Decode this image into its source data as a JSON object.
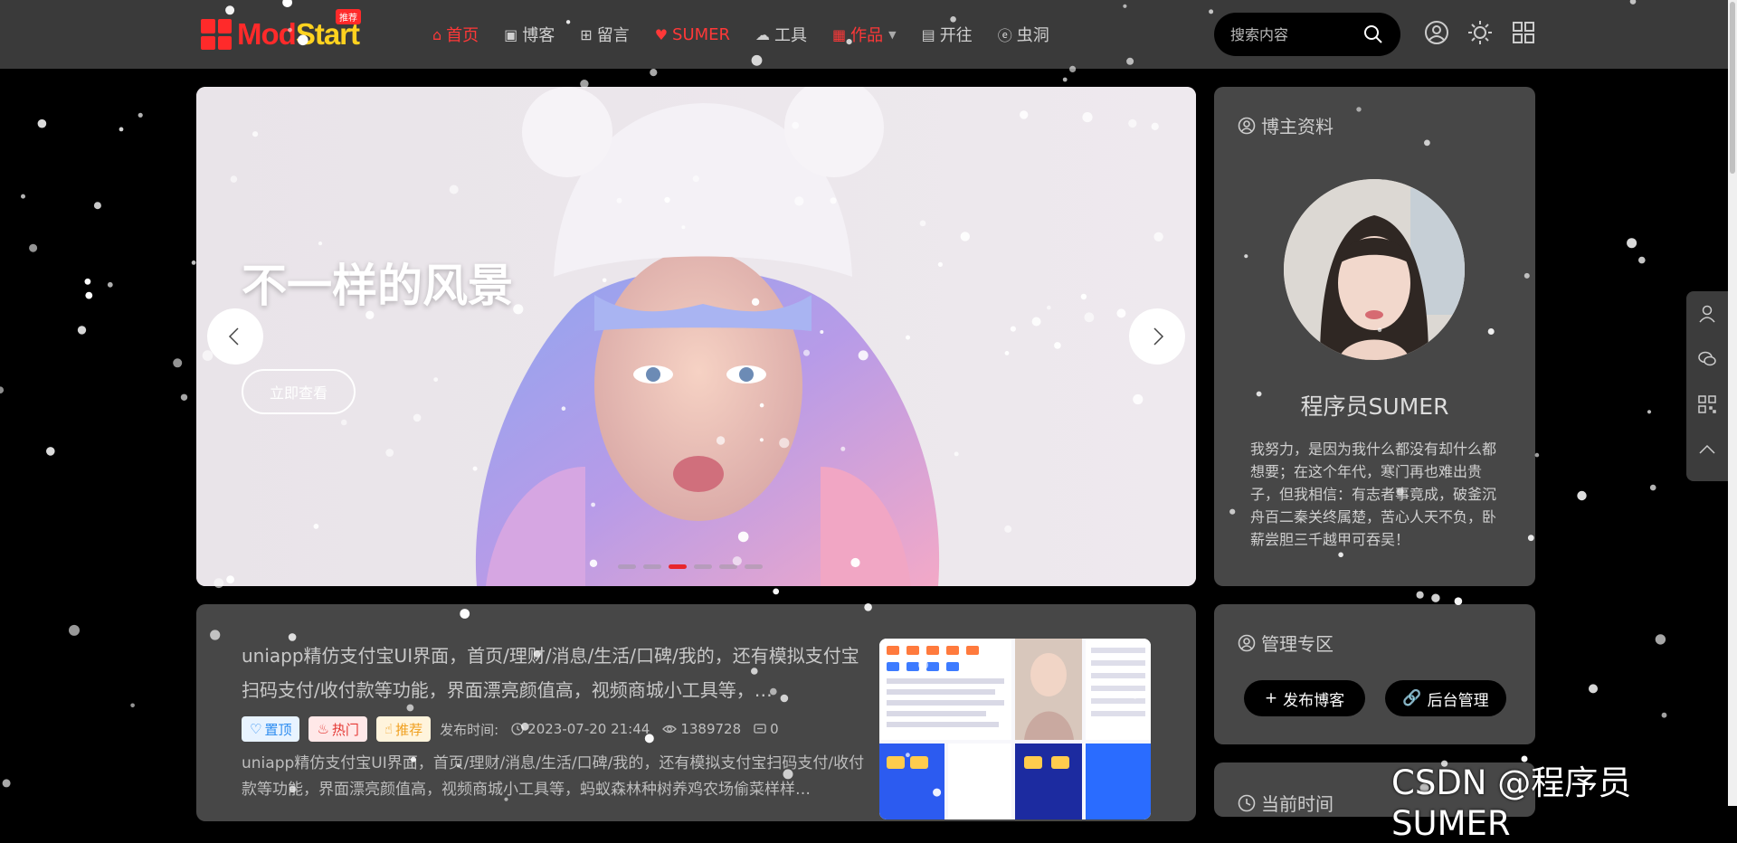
{
  "brand": {
    "logo_text_a": "Mod",
    "logo_text_b": "Start",
    "badge": "推荐",
    "accent": "#ff2a2a",
    "accent2": "#ffd21f"
  },
  "nav": [
    {
      "label": "首页",
      "icon": "home-icon",
      "active": true
    },
    {
      "label": "博客",
      "icon": "rss-icon"
    },
    {
      "label": "留言",
      "icon": "gift-icon"
    },
    {
      "label": "SUMER",
      "icon": "heart-icon",
      "active": true
    },
    {
      "label": "工具",
      "icon": "cloud-download-icon"
    },
    {
      "label": "作品",
      "icon": "grid-icon",
      "active": true,
      "dropdown": true
    },
    {
      "label": "开往",
      "icon": "train-icon"
    },
    {
      "label": "虫洞",
      "icon": "edge-icon"
    }
  ],
  "search": {
    "placeholder": "搜索内容"
  },
  "banner": {
    "title": "不一样的风景",
    "button": "立即查看",
    "slides": 6,
    "active_slide": 3
  },
  "profile": {
    "heading": "博主资料",
    "name": "程序员SUMER",
    "bio": "我努力，是因为我什么都没有却什么都想要；在这个年代，寒门再也难出贵子，但我相信：有志者事竟成，破釜沉舟百二秦关终属楚，苦心人天不负，卧薪尝胆三千越甲可吞吴！"
  },
  "admin": {
    "heading": "管理专区",
    "publish": "发布博客",
    "backend": "后台管理"
  },
  "clock": {
    "heading": "当前时间"
  },
  "article": {
    "title": "uniapp精仿支付宝UI界面，首页/理财/消息/生活/口碑/我的，还有模拟支付宝扫码支付/收付款等功能，界面漂亮颜值高，视频商城小工具等，…",
    "tags": {
      "top": "置顶",
      "hot": "热门",
      "rec": "推荐"
    },
    "time_label": "发布时间:",
    "time": "2023-07-20 21:44",
    "views": "1389728",
    "comments": "0",
    "summary": "uniapp精仿支付宝UI界面，首页/理财/消息/生活/口碑/我的，还有模拟支付宝扫码支付/收付款等功能，界面漂亮颜值高，视频商城小工具等，蚂蚁森林种树养鸡农场偷菜样样…"
  },
  "watermark": "CSDN @程序员SUMER"
}
